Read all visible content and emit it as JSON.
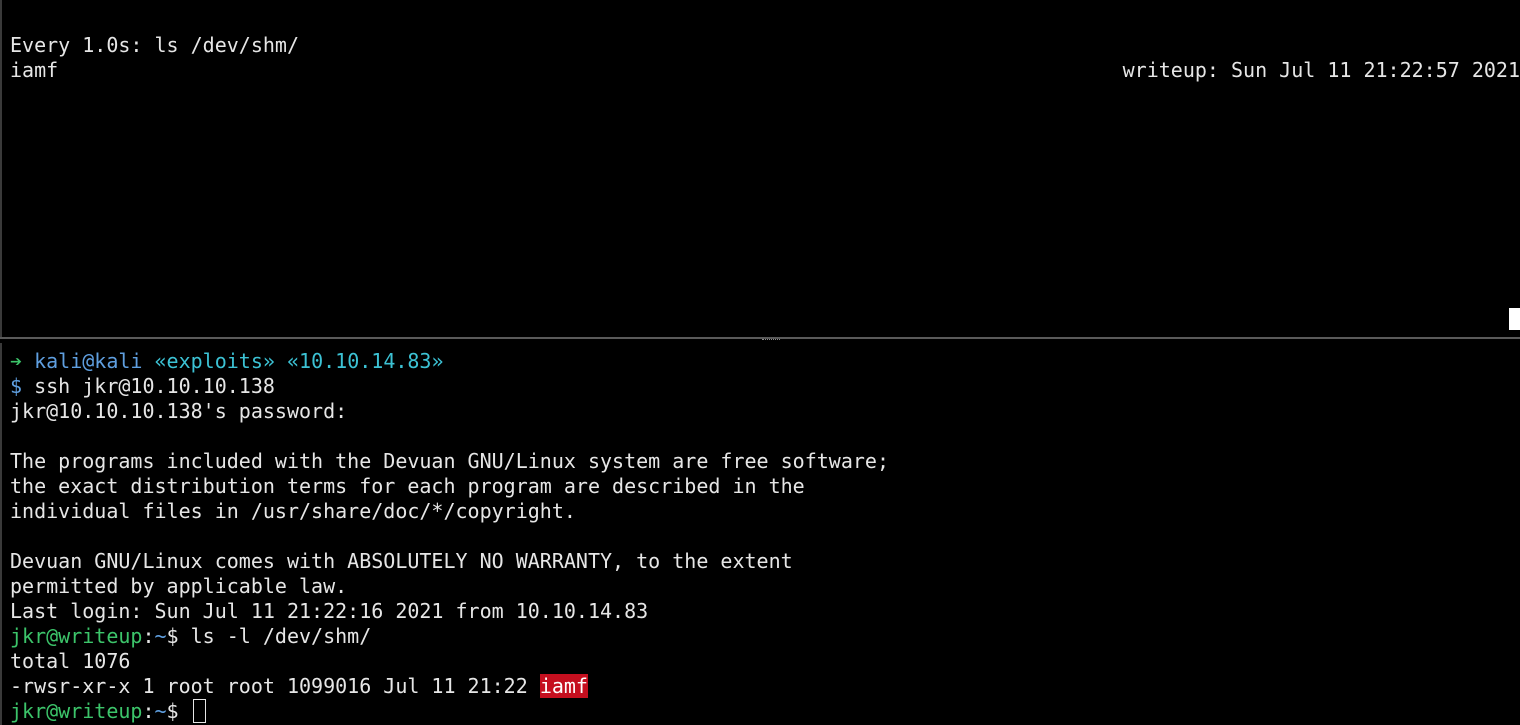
{
  "watch_pane": {
    "header_left": "Every 1.0s: ls /dev/shm/",
    "header_right": "writeup: Sun Jul 11 21:22:57 2021",
    "output": [
      "iamf"
    ]
  },
  "shell_pane": {
    "zsh_prompt": {
      "arrow": "➔",
      "user_host": "kali@kali",
      "dir": "«exploits»",
      "ip": "«10.10.14.83»",
      "dollar": "$",
      "command": " ssh jkr@10.10.10.138"
    },
    "password_prompt": "jkr@10.10.10.138's password:",
    "motd": [
      "",
      "The programs included with the Devuan GNU/Linux system are free software;",
      "the exact distribution terms for each program are described in the",
      "individual files in /usr/share/doc/*/copyright.",
      "",
      "Devuan GNU/Linux comes with ABSOLUTELY NO WARRANTY, to the extent",
      "permitted by applicable law."
    ],
    "last_login": "Last login: Sun Jul 11 21:22:16 2021 from 10.10.14.83",
    "remote_prompt": {
      "user_host": "jkr@writeup",
      "sep": ":",
      "path": "~",
      "dollar": "$ ",
      "command": "ls -l /dev/shm/"
    },
    "ls_total": "total 1076",
    "ls_entry": {
      "prefix": "-rwsr-xr-x 1 root root 1099016 Jul 11 21:22 ",
      "name": "iamf"
    },
    "final_prompt": {
      "user_host": "jkr@writeup",
      "sep": ":",
      "path": "~",
      "dollar": "$ "
    }
  },
  "colors": {
    "background": "#000000",
    "foreground": "#e6e6e6",
    "green": "#3cc46a",
    "blue": "#5f9fe0",
    "cyan": "#3cc2d4",
    "highlight_red": "#c50f1f"
  }
}
